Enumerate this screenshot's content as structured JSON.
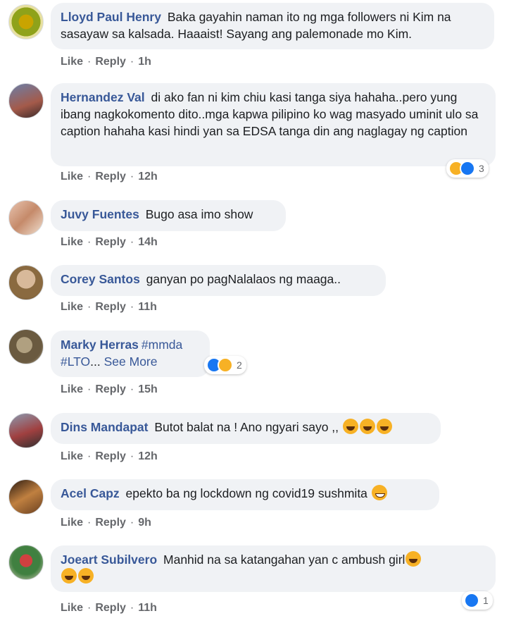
{
  "comments": [
    {
      "author": "Lloyd Paul Henry",
      "text": " Baka gayahin naman ito ng mga followers ni Kim na sasayaw sa kalsada. Haaaist! Sayang ang palemonade mo Kim.",
      "like": "Like",
      "reply": "Reply",
      "time": "1h"
    },
    {
      "author": "Hernandez Val",
      "text": " di ako fan ni kim chiu kasi tanga siya hahaha..pero yung ibang nagkokomento dito..mga kapwa pilipino ko wag masyado uminit ulo sa caption hahaha kasi hindi yan sa EDSA tanga din ang naglagay ng caption",
      "like": "Like",
      "reply": "Reply",
      "time": "12h",
      "reactions": {
        "count": "3",
        "icons": [
          "haha-icon",
          "like-icon"
        ]
      }
    },
    {
      "author": "Juvy Fuentes",
      "text": " Bugo asa imo show",
      "like": "Like",
      "reply": "Reply",
      "time": "14h"
    },
    {
      "author": "Corey Santos",
      "text": " ganyan po pagNalalaos ng maaga..",
      "like": "Like",
      "reply": "Reply",
      "time": "11h"
    },
    {
      "author": "Marky Herras",
      "hashtag1": "#mmda",
      "hashtag2": "#LTO",
      "ellipsis": "...",
      "see_more": "See More",
      "like": "Like",
      "reply": "Reply",
      "time": "15h",
      "reactions": {
        "count": "2",
        "icons": [
          "like-icon",
          "haha-icon"
        ]
      }
    },
    {
      "author": "Dins Mandapat",
      "text": " Butot balat na ! Ano ngyari sayo ,,",
      "emojis": [
        "rofl-emoji",
        "rofl-emoji",
        "rofl-emoji"
      ],
      "like": "Like",
      "reply": "Reply",
      "time": "12h"
    },
    {
      "author": "Acel Capz",
      "text": " epekto ba ng lockdown ng covid19 sushmita",
      "emojis": [
        "sweat-smile-emoji"
      ],
      "like": "Like",
      "reply": "Reply",
      "time": "9h"
    },
    {
      "author": "Joeart Subilvero",
      "text": " Manhid na sa katangahan yan c ambush girl",
      "emojis": [
        "laughing-emoji",
        "laughing-emoji",
        "laughing-emoji"
      ],
      "like": "Like",
      "reply": "Reply",
      "time": "11h",
      "reactions": {
        "count": "1",
        "icons": [
          "like-icon"
        ]
      }
    }
  ],
  "colors": {
    "author": "#385898",
    "bubble": "#f0f2f5",
    "meta": "#65676b",
    "like_blue": "#1877f2",
    "haha_yellow": "#f7b125"
  }
}
